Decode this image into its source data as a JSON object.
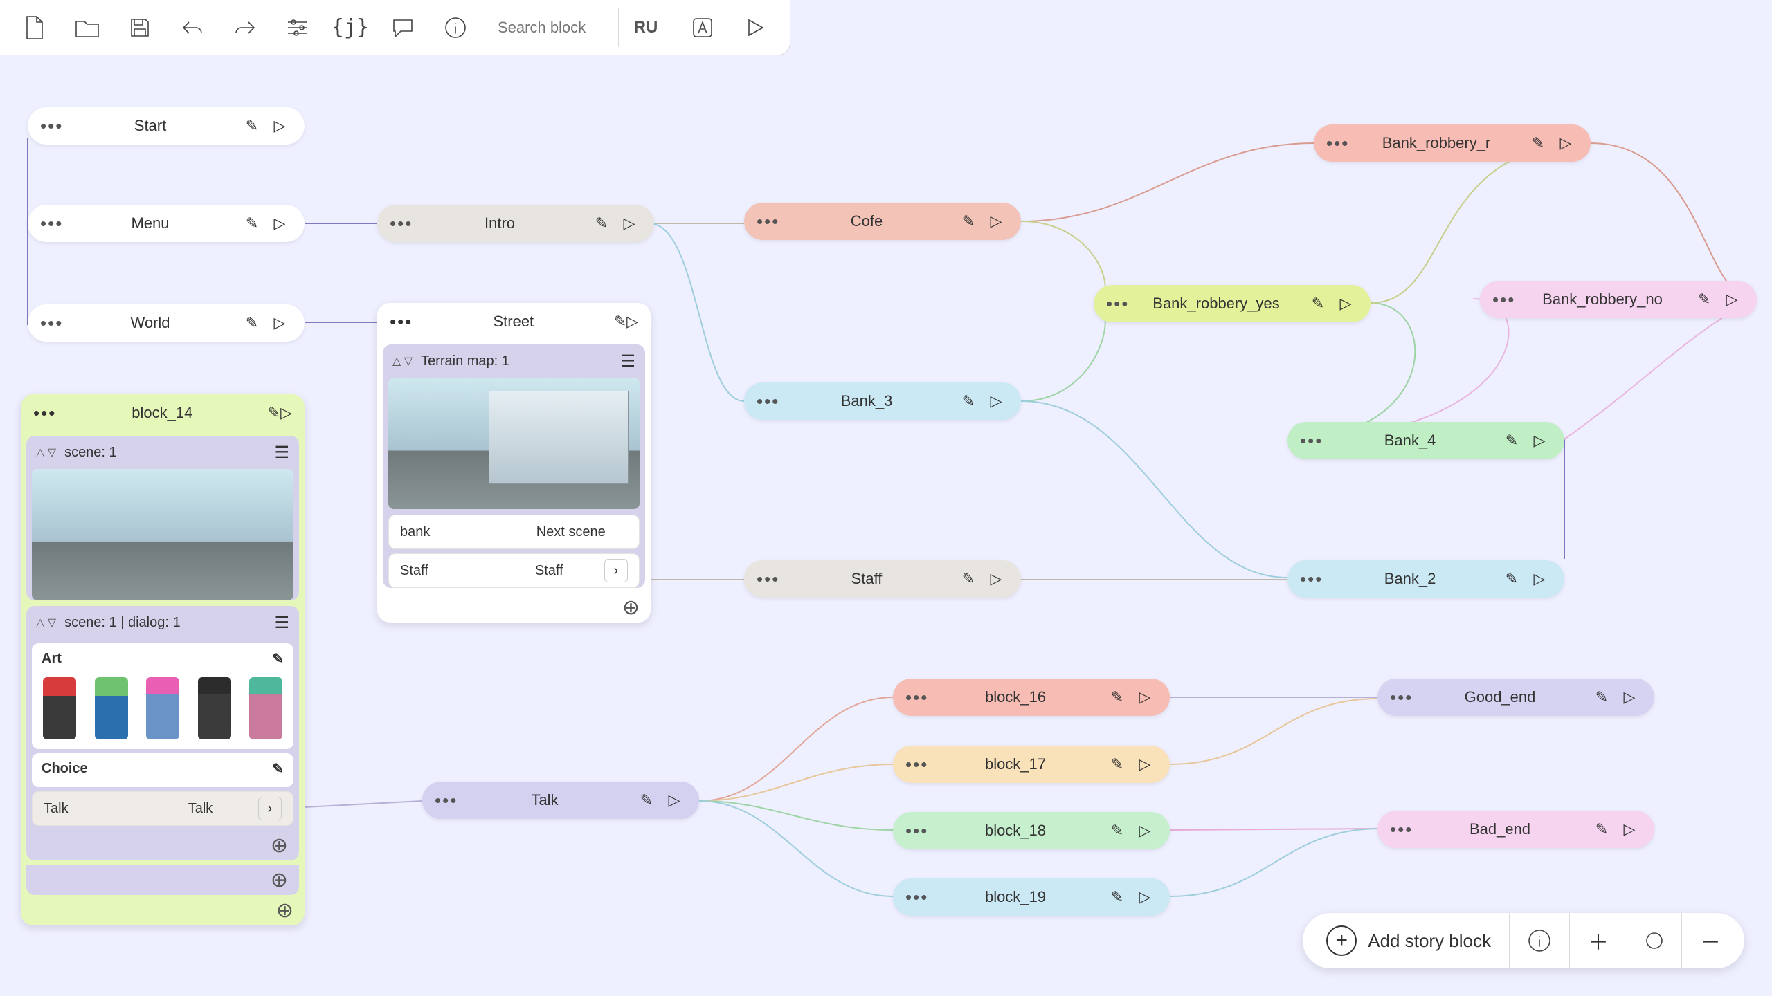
{
  "toolbar": {
    "lang": "RU",
    "search_placeholder": "Search block"
  },
  "nodes": {
    "start": "Start",
    "menu": "Menu",
    "world": "World",
    "intro": "Intro",
    "street": "Street",
    "cofe": "Cofe",
    "bank3": "Bank_3",
    "staff": "Staff",
    "bank_robbery_r": "Bank_robbery_r",
    "bank_robbery_yes": "Bank_robbery_yes",
    "bank_robbery_no": "Bank_robbery_no",
    "bank4": "Bank_4",
    "bank2": "Bank_2",
    "talk": "Talk",
    "b16": "block_16",
    "b17": "block_17",
    "b18": "block_18",
    "b19": "block_19",
    "good_end": "Good_end",
    "bad_end": "Bad_end"
  },
  "card14": {
    "title": "block_14",
    "scene_label": "scene: 1",
    "dialog_label": "scene: 1 | dialog: 1",
    "art_label": "Art",
    "choice_label": "Choice",
    "choice_left": "Talk",
    "choice_right": "Talk"
  },
  "cardStreet": {
    "title": "Street",
    "scene_label": "Terrain map: 1",
    "row1_l": "bank",
    "row1_r": "Next scene",
    "row2_l": "Staff",
    "row2_r": "Staff"
  },
  "bottombar": {
    "add_label": "Add story block"
  }
}
